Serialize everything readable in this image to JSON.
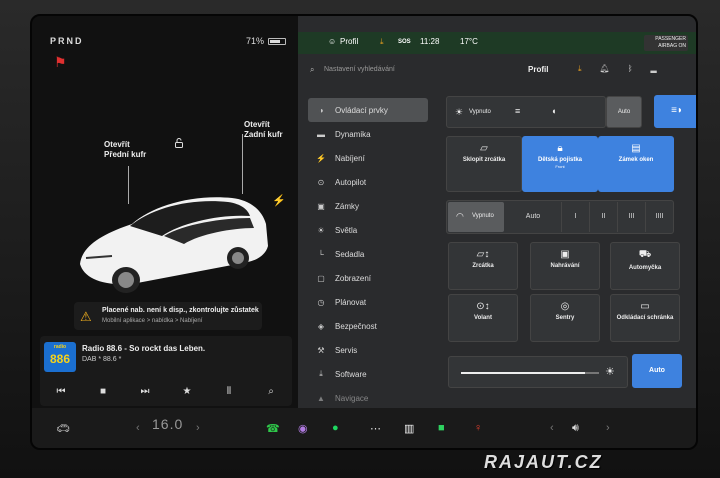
{
  "status": {
    "gear": "PRND",
    "battery_percent": "71%",
    "battery_level": 0.71
  },
  "car": {
    "front_trunk_label_1": "Otevřít",
    "front_trunk_label_2": "Přední kufr",
    "rear_trunk_label_1": "Otevřít",
    "rear_trunk_label_2": "Zadní kufr"
  },
  "notice": {
    "line1": "Placené nab. není k disp., zkontrolujte zůstatek",
    "line2": "Mobilní aplikace > nabídka > Nabíjení"
  },
  "radio": {
    "logo_small": "radio",
    "logo_big": "886",
    "title": "Radio 88.6 - So rockt das Leben.",
    "subtitle": "DAB * 88.6 *"
  },
  "topbar": {
    "profile": "Profil",
    "sos": "SOS",
    "time": "11:28",
    "temperature": "17°C",
    "airbag_line1": "PASSENGER",
    "airbag_line2": "AIRBAG ON"
  },
  "search": {
    "placeholder": "Nastavení vyhledávání",
    "profile": "Profil"
  },
  "menu": [
    {
      "icon": "toggle-icon",
      "label": "Ovládací prvky"
    },
    {
      "icon": "car-icon",
      "label": "Dynamika"
    },
    {
      "icon": "bolt-icon",
      "label": "Nabíjení"
    },
    {
      "icon": "steering-icon",
      "label": "Autopilot"
    },
    {
      "icon": "lock-icon",
      "label": "Zámky"
    },
    {
      "icon": "light-icon",
      "label": "Světla"
    },
    {
      "icon": "seat-icon",
      "label": "Sedadla"
    },
    {
      "icon": "display-icon",
      "label": "Zobrazení"
    },
    {
      "icon": "clock-icon",
      "label": "Plánovat"
    },
    {
      "icon": "shield-icon",
      "label": "Bezpečnost"
    },
    {
      "icon": "wrench-icon",
      "label": "Servis"
    },
    {
      "icon": "download-icon",
      "label": "Software"
    },
    {
      "icon": "navigation-icon",
      "label": "Navigace"
    }
  ],
  "controls": {
    "lights_off": "Vypnuto",
    "lights_auto": "Auto",
    "fold_mirrors": "Sklopit zrcátka",
    "child_lock": "Dětská pojistka",
    "child_lock_sub": "Front",
    "window_lock": "Zámek oken",
    "wiper_off": "Vypnuto",
    "wiper_auto": "Auto",
    "wiper_levels": [
      "I",
      "II",
      "III",
      "IIII"
    ],
    "mirrors": "Zrcátka",
    "recording": "Nahrávání",
    "car_wash": "Automyčka",
    "steering": "Volant",
    "sentry": "Sentry",
    "glovebox": "Odkládací schránka",
    "brightness_auto": "Auto",
    "brightness_level": 0.9
  },
  "dock": {
    "temp": "16.0"
  },
  "watermark": "RAJAUT.CZ"
}
